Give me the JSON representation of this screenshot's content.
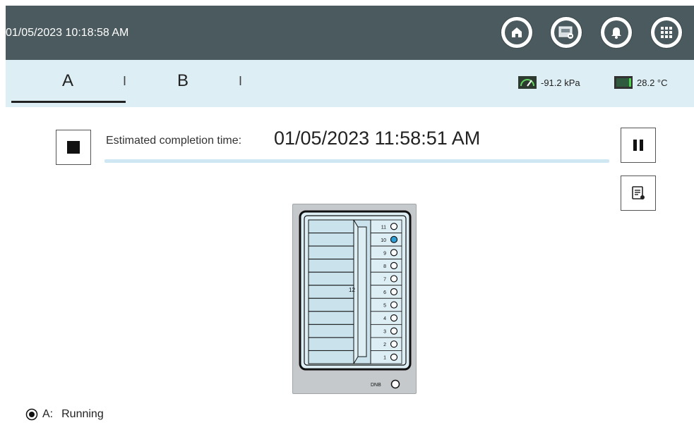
{
  "topbar": {
    "datetime": "01/05/2023 10:18:58 AM",
    "buttons": [
      {
        "icon": "home-icon"
      },
      {
        "icon": "display-icon"
      },
      {
        "icon": "bell-icon"
      },
      {
        "icon": "grid-menu-icon"
      }
    ]
  },
  "tabs": [
    {
      "label": "A",
      "active": true
    },
    {
      "label": "B",
      "active": false
    }
  ],
  "tab_separator": "I",
  "sensors": {
    "pressure": "-91.2 kPa",
    "temperature": "28.2 °C"
  },
  "run": {
    "estimated_label": "Estimated completion time:",
    "estimated_value": "01/05/2023 11:58:51 AM"
  },
  "device": {
    "positions_right": [
      "11",
      "10",
      "9",
      "8",
      "7",
      "6",
      "5",
      "4",
      "3",
      "2",
      "1"
    ],
    "active_position": "10",
    "center_label": "12",
    "bottom_label": "DNB"
  },
  "status": {
    "label": "A:",
    "value": "Running"
  },
  "colors": {
    "topbar": "#4a5a5f",
    "tabbar": "#ddeef5",
    "accent": "#2e9fd6"
  }
}
